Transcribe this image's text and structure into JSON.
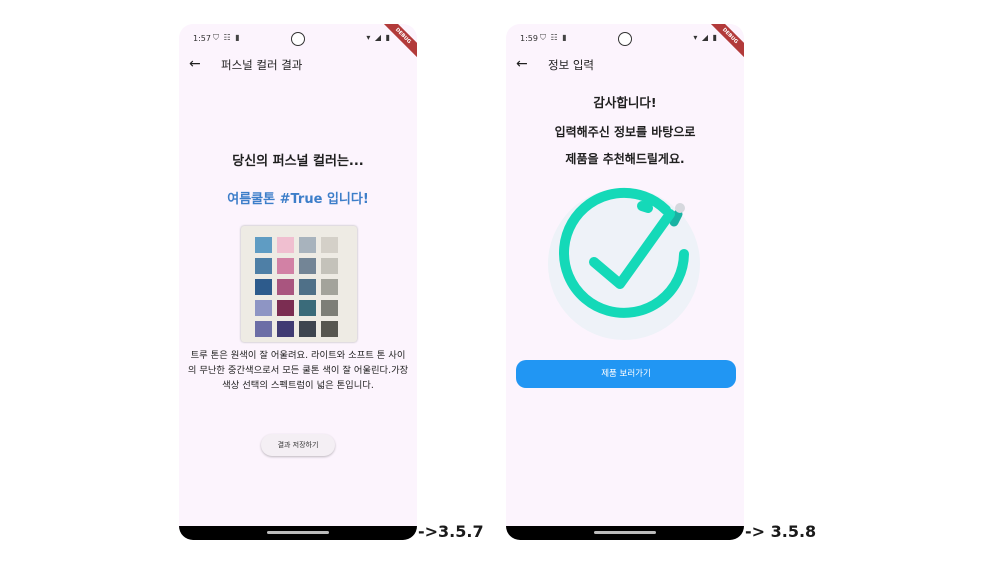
{
  "screen1": {
    "status": {
      "time": "1:57",
      "icons": "⛉ ☷ ▮",
      "right": "▾ ◢ ▮"
    },
    "debug_banner": "DEBUG",
    "appbar": {
      "back_icon": "←",
      "title": "퍼스널 컬러 결과"
    },
    "heading": "당신의 퍼스널 컬러는...",
    "result": "여름쿨톤 #True 입니다!",
    "palette_colors": [
      "#5f9cc3",
      "#f0bfd0",
      "#a8b3bd",
      "#d4d0c8",
      "#4e7fa6",
      "#d281a5",
      "#738596",
      "#c4c2ba",
      "#2d5b8c",
      "#a9557f",
      "#4f7088",
      "#a3a39b",
      "#8e95c4",
      "#7b2d52",
      "#3a6b7a",
      "#7d7e77",
      "#6c6ea6",
      "#403b73",
      "#3e4550",
      "#575650"
    ],
    "description": "트루 톤은 원색이 잘 어울려요. 라이트와 소프트 톤 사이의 무난한 중간색으로서 모든 쿨톤 색이 잘 어울린다.가장 색상 선택의 스펙트럼이 넓은 톤입니다.",
    "save_button": "결과 저장하기"
  },
  "screen2": {
    "status": {
      "time": "1:59",
      "icons": "⛉ ☷ ▮",
      "right": "▾ ◢ ▮"
    },
    "debug_banner": "DEBUG",
    "appbar": {
      "back_icon": "←",
      "title": "정보 입력"
    },
    "thanks": "감사합니다!",
    "line1": "입력해주신 정보를 바탕으로",
    "line2": "제품을 추천해드릴게요.",
    "accent": "#14d9b8",
    "button": "제품 보러가기"
  },
  "captions": {
    "first": "->3.5.7",
    "second": "-> 3.5.8"
  }
}
